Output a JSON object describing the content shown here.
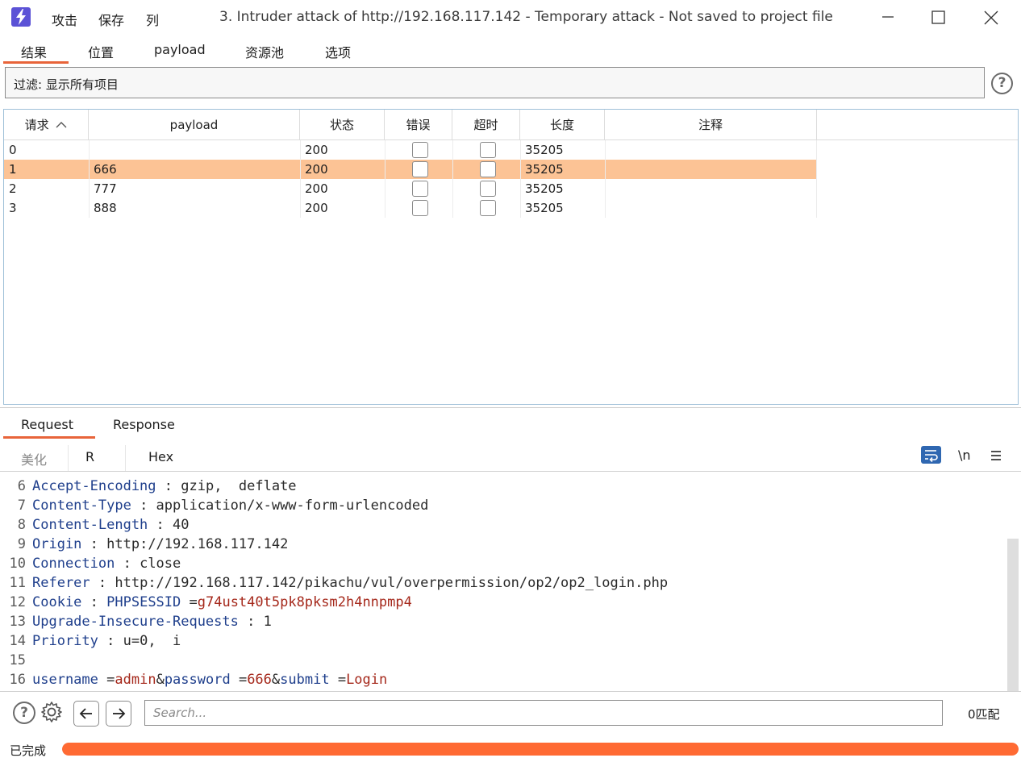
{
  "titlebar": {
    "menu": [
      "攻击",
      "保存",
      "列"
    ],
    "title": "3. Intruder attack of http://192.168.117.142 - Temporary attack - Not saved to project file"
  },
  "main_tabs": [
    "结果",
    "位置",
    "payload",
    "资源池",
    "选项"
  ],
  "filter": {
    "label": "过滤: 显示所有项目",
    "help": "?"
  },
  "table": {
    "columns": [
      "请求",
      "payload",
      "状态",
      "错误",
      "超时",
      "长度",
      "注释"
    ],
    "sort_indicator": "^",
    "rows": [
      {
        "request": "0",
        "payload": "",
        "status": "200",
        "error": false,
        "timeout": false,
        "length": "35205",
        "comment": ""
      },
      {
        "request": "1",
        "payload": "666",
        "status": "200",
        "error": false,
        "timeout": false,
        "length": "35205",
        "comment": ""
      },
      {
        "request": "2",
        "payload": "777",
        "status": "200",
        "error": false,
        "timeout": false,
        "length": "35205",
        "comment": ""
      },
      {
        "request": "3",
        "payload": "888",
        "status": "200",
        "error": false,
        "timeout": false,
        "length": "35205",
        "comment": ""
      }
    ],
    "selected_row": 1
  },
  "rr_tabs": [
    "Request",
    "Response"
  ],
  "sub_tabs": [
    "美化",
    "R",
    "Hex"
  ],
  "editor_tools": {
    "newline": "\\n"
  },
  "editor": {
    "lines": [
      {
        "n": "6",
        "key": "Accept-Encoding",
        "sep": " : ",
        "val": "gzip,  deflate"
      },
      {
        "n": "7",
        "key": "Content-Type",
        "sep": " : ",
        "val": "application/x-www-form-urlencoded"
      },
      {
        "n": "8",
        "key": "Content-Length",
        "sep": " : ",
        "val": "40"
      },
      {
        "n": "9",
        "key": "Origin",
        "sep": " : ",
        "val": "http://192.168.117.142"
      },
      {
        "n": "10",
        "key": "Connection",
        "sep": " : ",
        "val": "close"
      },
      {
        "n": "11",
        "key": "Referer",
        "sep": " : ",
        "val": "http://192.168.117.142/pikachu/vul/overpermission/op2/op2_login.php"
      },
      {
        "n": "12",
        "key": "Cookie",
        "sep": " : ",
        "cookie_name": "PHPSESSID",
        "cookie_eq": " =",
        "cookie_val": "g74ust40t5pk8pksm2h4nnpmp4"
      },
      {
        "n": "13",
        "key": "Upgrade-Insecure-Requests",
        "sep": " : ",
        "val": "1"
      },
      {
        "n": "14",
        "key": "Priority",
        "sep": " : ",
        "val": "u=0,  i"
      },
      {
        "n": "15"
      },
      {
        "n": "16",
        "body": [
          {
            "t": "username",
            "c": "k"
          },
          {
            "t": " =",
            "c": "v"
          },
          {
            "t": "admin",
            "c": "r"
          },
          {
            "t": "&",
            "c": "v"
          },
          {
            "t": "password",
            "c": "k"
          },
          {
            "t": " =",
            "c": "v"
          },
          {
            "t": "666",
            "c": "r"
          },
          {
            "t": "&",
            "c": "v"
          },
          {
            "t": "submit",
            "c": "k"
          },
          {
            "t": " =",
            "c": "v"
          },
          {
            "t": "Login",
            "c": "r"
          }
        ]
      }
    ]
  },
  "search": {
    "placeholder": "Search...",
    "matches": "0匹配"
  },
  "status": {
    "text": "已完成",
    "progress": 1.0,
    "progress_color": "#ff6a33"
  },
  "colors": {
    "accent": "#e8643a",
    "selected_row": "#fcc395",
    "logo": "#5b52d6"
  },
  "icons": [
    "burp-logo-icon",
    "minimize-icon",
    "maximize-icon",
    "close-icon",
    "help-icon",
    "wrap-icon",
    "menu-icon",
    "settings-icon",
    "arrow-left-icon",
    "arrow-right-icon",
    "sort-up-icon"
  ]
}
